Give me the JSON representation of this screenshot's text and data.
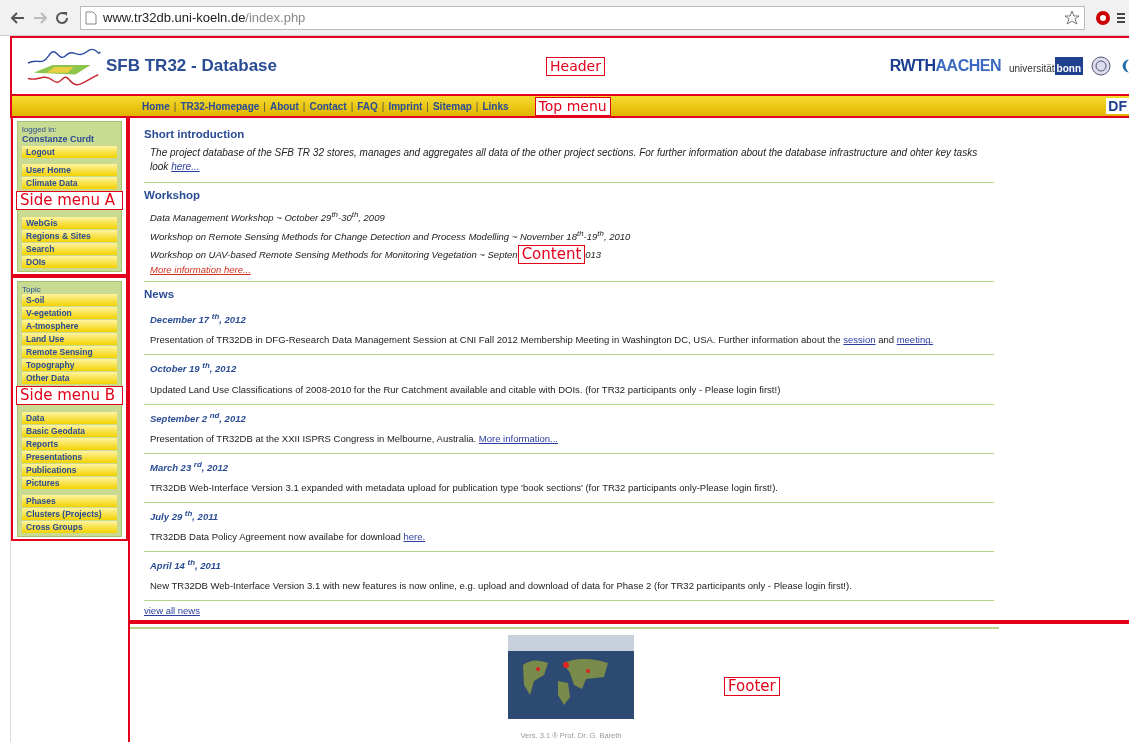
{
  "browser": {
    "url_host": "www.tr32db.uni-koeln.de",
    "url_path": "/index.php"
  },
  "header": {
    "title": "SFB TR32 - Database",
    "annotation": "Header",
    "logos": [
      {
        "kind": "rwth",
        "parts": [
          "RWTH",
          "AACHEN"
        ]
      },
      {
        "kind": "bonn",
        "parts": [
          "universität",
          "bonn"
        ]
      }
    ]
  },
  "top_menu": {
    "items": [
      {
        "kind": "link",
        "text": "Home"
      },
      {
        "kind": "separator",
        "text": "|"
      },
      {
        "kind": "link",
        "text": "TR32-Homepage"
      },
      {
        "kind": "separator",
        "text": "|"
      },
      {
        "kind": "link",
        "text": "About"
      },
      {
        "kind": "separator",
        "text": "|"
      },
      {
        "kind": "link",
        "text": "Contact"
      },
      {
        "kind": "separator",
        "text": "|"
      },
      {
        "kind": "link",
        "text": "FAQ"
      },
      {
        "kind": "separator",
        "text": "|"
      },
      {
        "kind": "link",
        "text": "Imprint"
      },
      {
        "kind": "separator",
        "text": "|"
      },
      {
        "kind": "link",
        "text": "Sitemap"
      },
      {
        "kind": "separator",
        "text": "|"
      },
      {
        "kind": "link",
        "text": "Links"
      }
    ],
    "annotation": "Top menu",
    "cut_logo": "DF"
  },
  "side_menu_a": {
    "logged_in_label": "logged in:",
    "user": "Constanze Curdt",
    "groups": [
      {
        "items": [
          "Logout"
        ]
      },
      {
        "items": [
          "User Home",
          "Climate Data"
        ],
        "annotation": "Side menu A"
      },
      {
        "items": [
          "WebGis",
          "Regions & Sites",
          "Search",
          "DOIs"
        ]
      }
    ]
  },
  "side_menu_b": {
    "heading": "Topic",
    "groups": [
      {
        "items": [
          "S-oil",
          "V-egetation",
          "A-tmosphere",
          "Land Use",
          "Remote Sensing",
          "Topography",
          "Other Data"
        ],
        "annotation": "Side menu B"
      },
      {
        "items": [
          "Data",
          "Basic Geodata",
          "Reports",
          "Presentations",
          "Publications",
          "Pictures"
        ]
      },
      {
        "items": [
          "Phases",
          "Clusters (Projects)",
          "Cross Groups"
        ]
      }
    ]
  },
  "content": {
    "intro": {
      "heading": "Short introduction",
      "text": "The project database of the SFB TR 32 stores, manages and aggregates all data of the other project sections. For further information about the database infrastructure and ohter key tasks look",
      "link": "here..."
    },
    "workshop": {
      "heading": "Workshop",
      "lines": [
        {
          "text": "Data Management Workshop ~ October 29$^{th}$-30$^{th}$, 2009"
        },
        {
          "text": "Workshop on Remote Sensing Methods for Change Detection and Process Modelling ~ November 18$^{th}$-19$^{th}$, 2010"
        },
        {
          "text": "Workshop on UAV-based Remote Sensing Methods for Monitoring Vegetation ~ Septen",
          "annotation": "Content",
          "tail": "013"
        }
      ],
      "link": "More information here..."
    },
    "news": {
      "heading": "News",
      "items": [
        {
          "date": "December 17 $^{th}$, 2012",
          "segments": [
            {
              "kind": "text",
              "text": "Presentation of TR32DB in DFG-Research Data Management Session at CNI Fall 2012 Membership Meeting in Washington DC, USA. Further information about the"
            },
            {
              "kind": "link",
              "text": "session"
            },
            {
              "kind": "text",
              "text": "and"
            },
            {
              "kind": "link",
              "text": "meeting."
            }
          ]
        },
        {
          "date": "October 19 $^{th}$, 2012",
          "segments": [
            {
              "kind": "text",
              "text": "Updated Land Use Classifications of 2008-2010 for the Rur Catchment available and citable with DOIs. (for TR32 participants only - Please login first!)"
            }
          ]
        },
        {
          "date": "September 2 $^{nd}$, 2012",
          "segments": [
            {
              "kind": "text",
              "text": "Presentation of TR32DB at the XXII ISPRS Congress in Melbourne, Australia."
            },
            {
              "kind": "link",
              "text": "More information..."
            }
          ]
        },
        {
          "date": "March 23 $^{rd}$, 2012",
          "segments": [
            {
              "kind": "text",
              "text": "TR32DB Web-Interface Version 3.1 expanded with metadata upload for publication type 'book sections' (for TR32 participants only-Please login first!)."
            }
          ]
        },
        {
          "date": "July 29 $^{th}$, 2011",
          "segments": [
            {
              "kind": "text",
              "text": "TR32DB Data Policy Agreement now availabe for download"
            },
            {
              "kind": "link",
              "text": "here."
            }
          ]
        },
        {
          "date": "April 14 $^{th}$, 2011",
          "segments": [
            {
              "kind": "text",
              "text": "New TR32DB Web-Interface Version 3.1 with new features is now online, e.g. upload and download of data for Phase 2 (for TR32 participants only - Please login first!)."
            }
          ]
        }
      ],
      "all_link": "view all news"
    }
  },
  "footer": {
    "annotation": "Footer",
    "version": "Vers. 3.1 ® Prof. Dr. G. Bareth"
  }
}
